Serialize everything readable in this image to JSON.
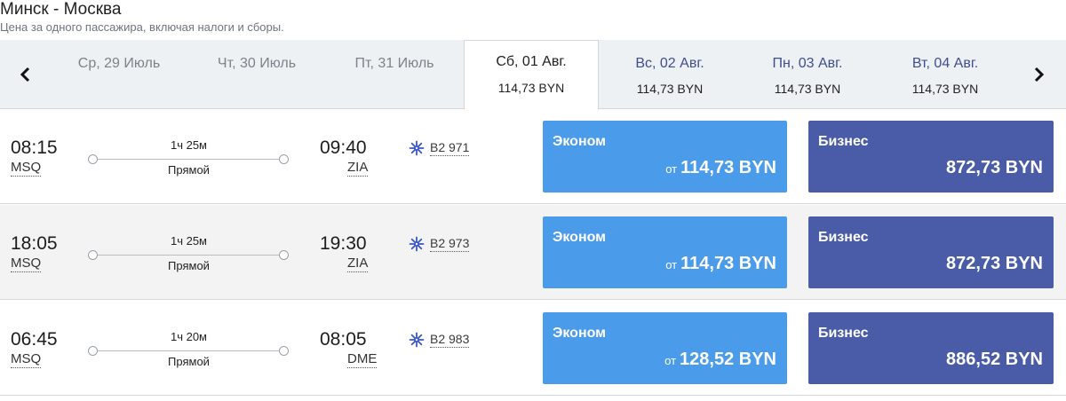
{
  "header": {
    "route": "Минск - Москва",
    "subtitle": "Цена за одного пассажира, включая налоги и сборы."
  },
  "dates": [
    {
      "label": "Ср, 29 Июль",
      "price": "",
      "state": "past"
    },
    {
      "label": "Чт, 30 Июль",
      "price": "",
      "state": "past"
    },
    {
      "label": "Пт, 31 Июль",
      "price": "",
      "state": "past"
    },
    {
      "label": "Сб, 01 Авг.",
      "price": "114,73 BYN",
      "state": "active"
    },
    {
      "label": "Вс, 02 Авг.",
      "price": "114,73 BYN",
      "state": "future"
    },
    {
      "label": "Пн, 03 Авг.",
      "price": "114,73 BYN",
      "state": "future"
    },
    {
      "label": "Вт, 04 Авг.",
      "price": "114,73 BYN",
      "state": "future"
    }
  ],
  "icons": {
    "prev": "chevron-left-icon",
    "next": "chevron-right-icon",
    "airline": "belavia-logo-icon"
  },
  "colors": {
    "economy": "#4a9be9",
    "business": "#4a5ba7",
    "airline_icon": "#3b57c4"
  },
  "flights": [
    {
      "departure_time": "08:15",
      "departure_code": "MSQ",
      "duration": "1ч 25м",
      "stops": "Прямой",
      "arrival_time": "09:40",
      "arrival_code": "ZIA",
      "flight_number": "B2 971",
      "economy": {
        "name": "Эконом",
        "from": "от",
        "price": "114,73 BYN"
      },
      "business": {
        "name": "Бизнес",
        "price": "872,73 BYN"
      }
    },
    {
      "departure_time": "18:05",
      "departure_code": "MSQ",
      "duration": "1ч 25м",
      "stops": "Прямой",
      "arrival_time": "19:30",
      "arrival_code": "ZIA",
      "flight_number": "B2 973",
      "economy": {
        "name": "Эконом",
        "from": "от",
        "price": "114,73 BYN"
      },
      "business": {
        "name": "Бизнес",
        "price": "872,73 BYN"
      }
    },
    {
      "departure_time": "06:45",
      "departure_code": "MSQ",
      "duration": "1ч 20м",
      "stops": "Прямой",
      "arrival_time": "08:05",
      "arrival_code": "DME",
      "flight_number": "B2 983",
      "economy": {
        "name": "Эконом",
        "from": "от",
        "price": "128,52 BYN"
      },
      "business": {
        "name": "Бизнес",
        "price": "886,52 BYN"
      }
    }
  ]
}
